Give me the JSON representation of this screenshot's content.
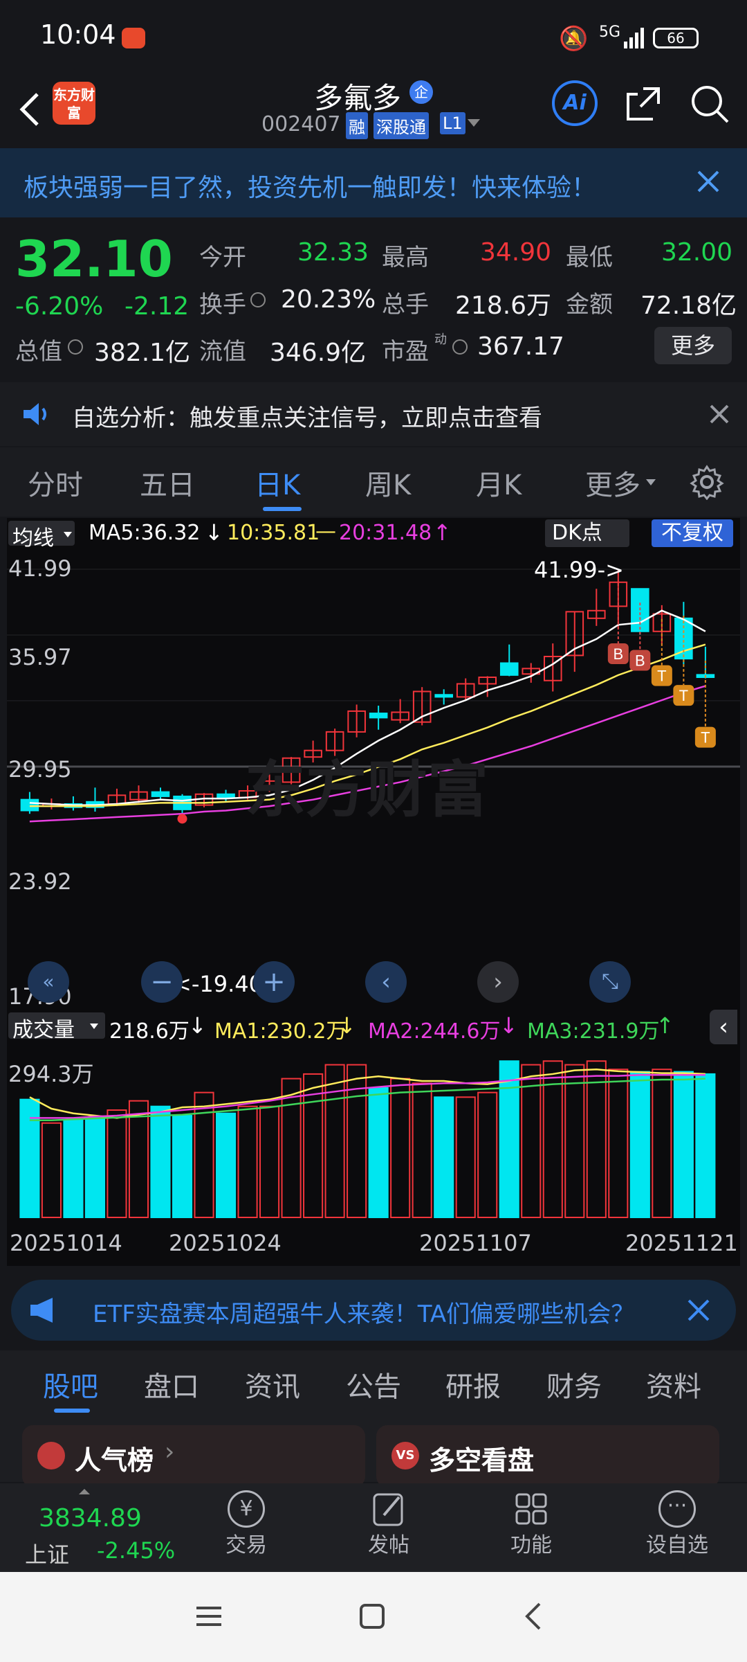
{
  "status": {
    "time": "10:04",
    "battery": "66",
    "network": "5G"
  },
  "header": {
    "stock_name": "多氟多",
    "badge": "企",
    "code": "002407",
    "tags": [
      "融",
      "深股通",
      "L1"
    ],
    "logo_text": "东方财富"
  },
  "banner": {
    "text": "板块强弱一目了然，投资先机一触即发！快来体验！"
  },
  "quote": {
    "price": "32.10",
    "change_pct": "-6.20%",
    "change": "-2.12",
    "fields": [
      {
        "label": "今开",
        "value": "32.33",
        "color": "green"
      },
      {
        "label": "最高",
        "value": "34.90",
        "color": "red"
      },
      {
        "label": "最低",
        "value": "32.00",
        "color": "green"
      },
      {
        "label": "换手",
        "value": "20.23%",
        "color": "white"
      },
      {
        "label": "总手",
        "value": "218.6万",
        "color": "white"
      },
      {
        "label": "金额",
        "value": "72.18亿",
        "color": "white"
      },
      {
        "label": "总值",
        "value": "382.1亿",
        "color": "white"
      },
      {
        "label": "流值",
        "value": "346.9亿",
        "color": "white"
      },
      {
        "label": "市盈",
        "value": "367.17",
        "color": "white"
      }
    ],
    "more_label": "更多",
    "pe_superscript": "动"
  },
  "notice": {
    "text": "自选分析：触发重点关注信号，立即点击查看"
  },
  "tabs": [
    "分时",
    "五日",
    "日K",
    "周K",
    "月K",
    "更多"
  ],
  "active_tab": "日K",
  "chart": {
    "indicator_label": "均线",
    "ma5": "MA5:36.32",
    "ma10": "10:35.81",
    "ma20": "20:31.48",
    "dk_label": "DK点",
    "fq_label": "不复权",
    "price_ticks": [
      "41.99",
      "35.97",
      "29.95",
      "23.92",
      "17.90"
    ],
    "high_marker": "41.99->",
    "low_marker": "<-19.40",
    "watermark": "东方财富",
    "vol_label": "成交量",
    "vol_value": "218.6万",
    "vma1": "MA1:230.2万",
    "vma2": "MA2:244.6万",
    "vma3": "MA3:231.9万",
    "vol_tick": "294.3万",
    "dates": [
      "20251014",
      "20251024",
      "20251107",
      "20251121"
    ],
    "colors": {
      "up": "#f2353b",
      "down": "#00e6f0",
      "ma5": "#ffffff",
      "ma10": "#ffec5c",
      "ma20": "#e83fe0",
      "vma3": "#3fd65a"
    }
  },
  "chart_data": {
    "type": "candlestick",
    "candles": [
      {
        "o": 20.9,
        "c": 19.9,
        "h": 21.6,
        "l": 19.6
      },
      {
        "o": 20.3,
        "c": 20.5,
        "h": 21.0,
        "l": 20.0
      },
      {
        "o": 20.5,
        "c": 20.2,
        "h": 21.2,
        "l": 19.9
      },
      {
        "o": 20.7,
        "c": 20.2,
        "h": 22.0,
        "l": 19.8
      },
      {
        "o": 20.5,
        "c": 21.3,
        "h": 21.9,
        "l": 20.3
      },
      {
        "o": 20.9,
        "c": 21.6,
        "h": 22.2,
        "l": 20.6
      },
      {
        "o": 21.6,
        "c": 21.2,
        "h": 22.0,
        "l": 20.9
      },
      {
        "o": 21.2,
        "c": 20.0,
        "h": 21.4,
        "l": 19.4
      },
      {
        "o": 20.4,
        "c": 21.4,
        "h": 21.5,
        "l": 20.2
      },
      {
        "o": 21.4,
        "c": 21.1,
        "h": 21.8,
        "l": 20.7
      },
      {
        "o": 21.1,
        "c": 21.7,
        "h": 22.2,
        "l": 20.9
      },
      {
        "o": 21.8,
        "c": 22.6,
        "h": 23.2,
        "l": 21.6
      },
      {
        "o": 22.5,
        "c": 24.7,
        "h": 24.8,
        "l": 22.3
      },
      {
        "o": 24.8,
        "c": 25.4,
        "h": 26.3,
        "l": 24.3
      },
      {
        "o": 25.4,
        "c": 27.1,
        "h": 27.4,
        "l": 24.9
      },
      {
        "o": 27.1,
        "c": 29.0,
        "h": 29.6,
        "l": 26.6
      },
      {
        "o": 28.8,
        "c": 28.4,
        "h": 29.5,
        "l": 27.3
      },
      {
        "o": 28.2,
        "c": 28.9,
        "h": 30.1,
        "l": 27.9
      },
      {
        "o": 28.0,
        "c": 30.8,
        "h": 31.2,
        "l": 27.7
      },
      {
        "o": 30.5,
        "c": 30.3,
        "h": 31.0,
        "l": 29.6
      },
      {
        "o": 30.3,
        "c": 31.5,
        "h": 32.0,
        "l": 30.0
      },
      {
        "o": 31.5,
        "c": 32.1,
        "h": 32.2,
        "l": 30.3
      },
      {
        "o": 33.4,
        "c": 32.3,
        "h": 35.1,
        "l": 32.2
      },
      {
        "o": 32.4,
        "c": 32.9,
        "h": 33.4,
        "l": 31.6
      },
      {
        "o": 31.8,
        "c": 34.0,
        "h": 35.2,
        "l": 30.8
      },
      {
        "o": 34.1,
        "c": 38.1,
        "h": 38.1,
        "l": 32.6
      },
      {
        "o": 37.5,
        "c": 38.2,
        "h": 40.2,
        "l": 36.8
      },
      {
        "o": 38.6,
        "c": 40.8,
        "h": 41.99,
        "l": 36.6
      },
      {
        "o": 40.2,
        "c": 36.3,
        "h": 40.2,
        "l": 36.0
      },
      {
        "o": 36.3,
        "c": 37.9,
        "h": 38.7,
        "l": 35.1
      },
      {
        "o": 37.5,
        "c": 33.8,
        "h": 39.0,
        "l": 33.3
      },
      {
        "o": 32.33,
        "c": 32.1,
        "h": 34.9,
        "l": 32.0
      }
    ],
    "ma5": [
      20.6,
      20.5,
      20.4,
      20.4,
      20.5,
      20.7,
      20.9,
      20.8,
      21.0,
      21.0,
      21.1,
      21.3,
      21.8,
      22.7,
      23.8,
      25.1,
      26.3,
      27.3,
      28.5,
      29.3,
      30.0,
      30.9,
      31.5,
      32.2,
      33.3,
      34.7,
      35.6,
      36.9,
      37.1,
      38.2,
      37.4,
      36.3
    ],
    "ma10": [
      20.3,
      20.3,
      20.3,
      20.3,
      20.4,
      20.5,
      20.6,
      20.6,
      20.6,
      20.7,
      20.8,
      20.9,
      21.3,
      21.9,
      22.6,
      23.2,
      23.9,
      24.6,
      25.5,
      26.1,
      26.8,
      27.5,
      28.3,
      29.0,
      29.8,
      30.6,
      31.4,
      32.3,
      33.0,
      33.7,
      34.5,
      35.1
    ],
    "ma20": [
      18.9,
      19.0,
      19.1,
      19.2,
      19.3,
      19.4,
      19.5,
      19.6,
      19.8,
      19.9,
      20.1,
      20.3,
      20.6,
      20.9,
      21.3,
      21.7,
      22.1,
      22.5,
      23.0,
      23.5,
      24.0,
      24.6,
      25.2,
      25.8,
      26.5,
      27.2,
      27.9,
      28.6,
      29.3,
      30.0,
      30.7,
      31.3
    ],
    "volume": [
      255,
      204,
      210,
      216,
      232,
      252,
      240,
      220,
      270,
      225,
      240,
      240,
      300,
      310,
      330,
      330,
      280,
      300,
      290,
      260,
      260,
      270,
      338,
      330,
      338,
      330,
      338,
      320,
      315,
      320,
      315,
      310
    ],
    "vma1": [
      260,
      235,
      225,
      220,
      215,
      222,
      228,
      238,
      240,
      245,
      250,
      255,
      265,
      280,
      290,
      300,
      305,
      300,
      295,
      295,
      290,
      288,
      295,
      305,
      310,
      318,
      320,
      316,
      314,
      312,
      312,
      310
    ],
    "vma2": [
      215,
      215,
      215,
      218,
      220,
      224,
      228,
      232,
      236,
      240,
      246,
      252,
      260,
      266,
      272,
      278,
      282,
      286,
      288,
      290,
      290,
      292,
      296,
      300,
      302,
      304,
      306,
      306,
      308,
      308,
      308,
      308
    ],
    "vma3": [
      210,
      210,
      212,
      214,
      216,
      218,
      220,
      222,
      226,
      230,
      234,
      238,
      244,
      250,
      256,
      262,
      266,
      270,
      272,
      274,
      276,
      278,
      280,
      284,
      288,
      290,
      292,
      294,
      296,
      298,
      298,
      300
    ],
    "dk_signals": [
      {
        "i": 27,
        "t": "B"
      },
      {
        "i": 28,
        "t": "B"
      },
      {
        "i": 29,
        "t": "T"
      },
      {
        "i": 30,
        "t": "T"
      },
      {
        "i": 31,
        "t": "T"
      }
    ],
    "ylim": [
      17.9,
      41.99
    ],
    "vol_max": 294.3
  },
  "ad": {
    "text": "ETF实盘赛本周超强牛人来袭！TA们偏爱哪些机会？"
  },
  "subtabs": [
    "股吧",
    "盘口",
    "资讯",
    "公告",
    "研报",
    "财务",
    "资料"
  ],
  "active_subtab": "股吧",
  "cards": [
    {
      "title": "人气榜"
    },
    {
      "title": "多空看盘"
    }
  ],
  "bottom": {
    "index_value": "3834.89",
    "index_name": "上证",
    "index_change": "-2.45%",
    "actions": [
      "交易",
      "发帖",
      "功能",
      "设自选"
    ]
  }
}
